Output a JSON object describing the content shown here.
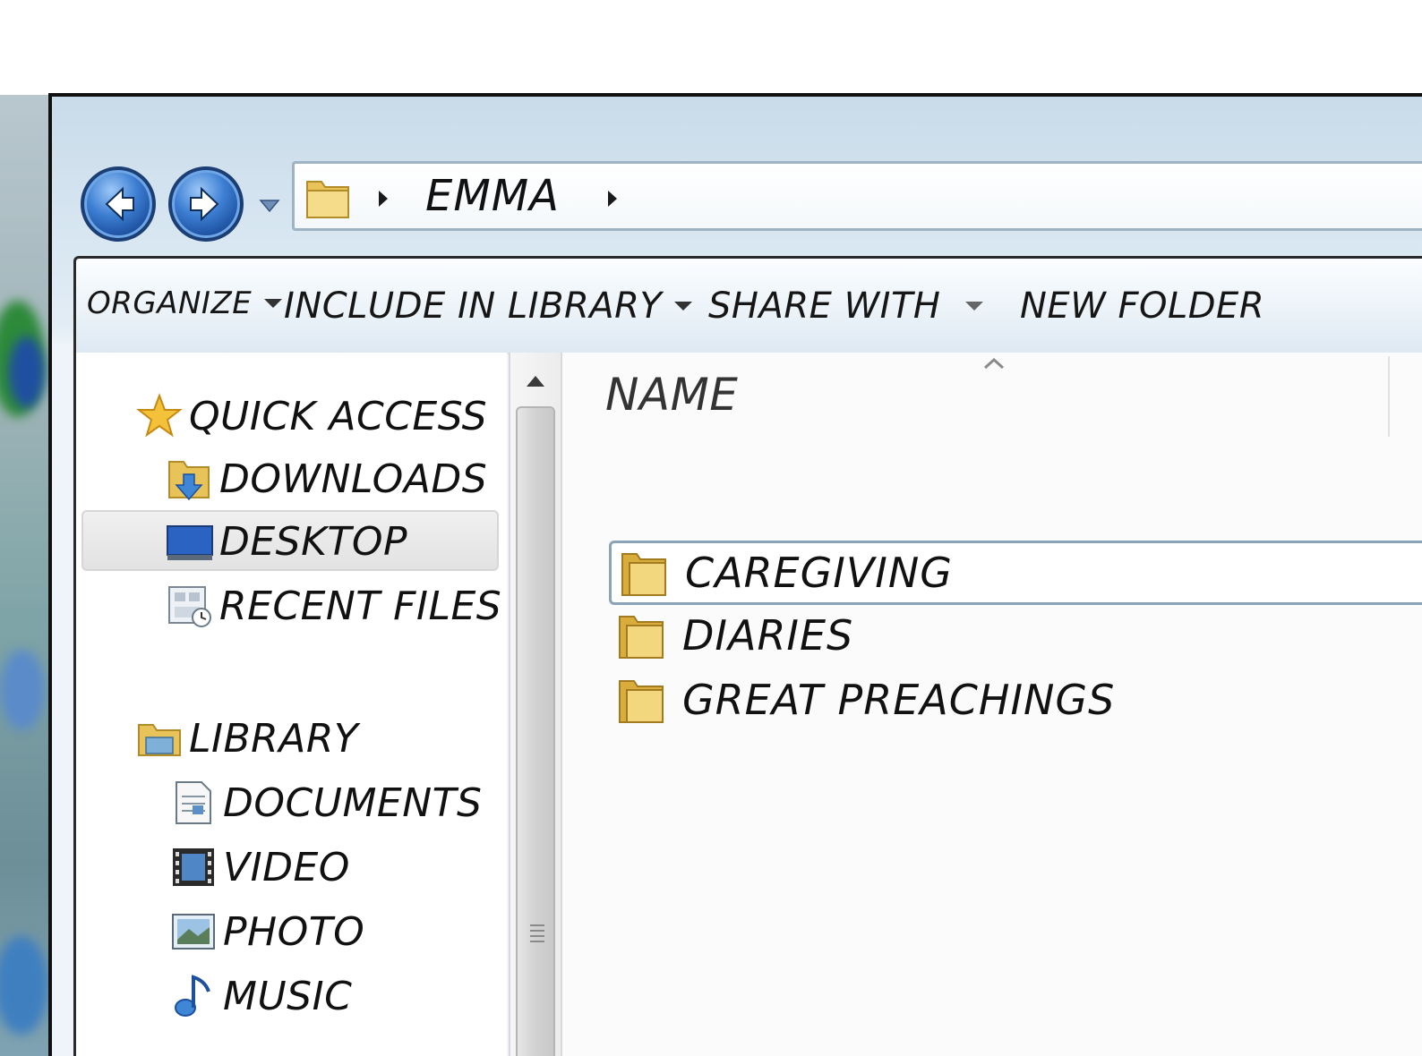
{
  "window": {
    "breadcrumb": [
      "EMMA"
    ]
  },
  "toolbar": {
    "organize_label": "ORGANIZE",
    "include_label": "INCLUDE IN LIBRARY",
    "share_label": "SHARE WITH",
    "new_folder_label": "NEW FOLDER"
  },
  "sidebar": {
    "quick_access": {
      "label": "QUICK ACCESS",
      "icon": "star-icon",
      "items": [
        {
          "label": "DOWNLOADS",
          "icon": "downloads-folder-icon"
        },
        {
          "label": "DESKTOP",
          "icon": "desktop-icon",
          "selected": true
        },
        {
          "label": "RECENT FILES",
          "icon": "recent-files-icon"
        }
      ]
    },
    "library": {
      "label": "LIBRARY",
      "icon": "library-icon",
      "items": [
        {
          "label": "DOCUMENTS",
          "icon": "documents-icon"
        },
        {
          "label": "VIDEO",
          "icon": "video-icon"
        },
        {
          "label": "PHOTO",
          "icon": "photo-icon"
        },
        {
          "label": "MUSIC",
          "icon": "music-icon"
        }
      ]
    }
  },
  "content": {
    "columns": [
      "NAME"
    ],
    "files": [
      {
        "name": "CAREGIVING",
        "icon": "folder-icon",
        "focused": true
      },
      {
        "name": "DIARIES",
        "icon": "folder-icon"
      },
      {
        "name": "GREAT PREACHINGS",
        "icon": "folder-icon"
      }
    ]
  },
  "colors": {
    "nav_button": "#2f6cc0",
    "folder": "#e8c35a",
    "selection": "#e6e6e6",
    "focus_border": "#8aa3b8"
  }
}
